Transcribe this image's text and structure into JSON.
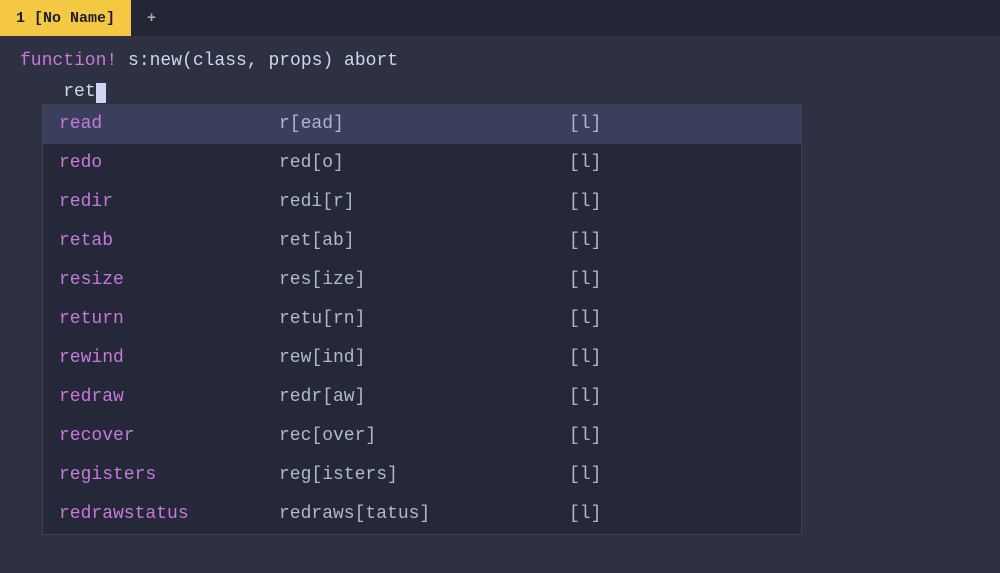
{
  "tabBar": {
    "tabs": [
      {
        "id": "tab1",
        "label": "1  [No Name]",
        "active": true
      },
      {
        "id": "tab-new",
        "label": "+",
        "active": false
      }
    ]
  },
  "editor": {
    "codeLine1": {
      "keyword": "function!",
      "rest": " s:new(class, props) abort"
    },
    "codeLine2": {
      "indent": "    ",
      "text": "ret"
    }
  },
  "autocomplete": {
    "rows": [
      {
        "col1": "read",
        "col2": "r[ead]",
        "col3": "[l]"
      },
      {
        "col1": "redo",
        "col2": "red[o]",
        "col3": "[l]"
      },
      {
        "col1": "redir",
        "col2": "redi[r]",
        "col3": "[l]"
      },
      {
        "col1": "retab",
        "col2": "ret[ab]",
        "col3": "[l]"
      },
      {
        "col1": "resize",
        "col2": "res[ize]",
        "col3": "[l]"
      },
      {
        "col1": "return",
        "col2": "retu[rn]",
        "col3": "[l]"
      },
      {
        "col1": "rewind",
        "col2": "rew[ind]",
        "col3": "[l]"
      },
      {
        "col1": "redraw",
        "col2": "redr[aw]",
        "col3": "[l]"
      },
      {
        "col1": "recover",
        "col2": "rec[over]",
        "col3": "[l]"
      },
      {
        "col1": "registers",
        "col2": "reg[isters]",
        "col3": "[l]"
      },
      {
        "col1": "redrawstatus",
        "col2": "redraws[tatus]",
        "col3": "[l]"
      }
    ]
  }
}
